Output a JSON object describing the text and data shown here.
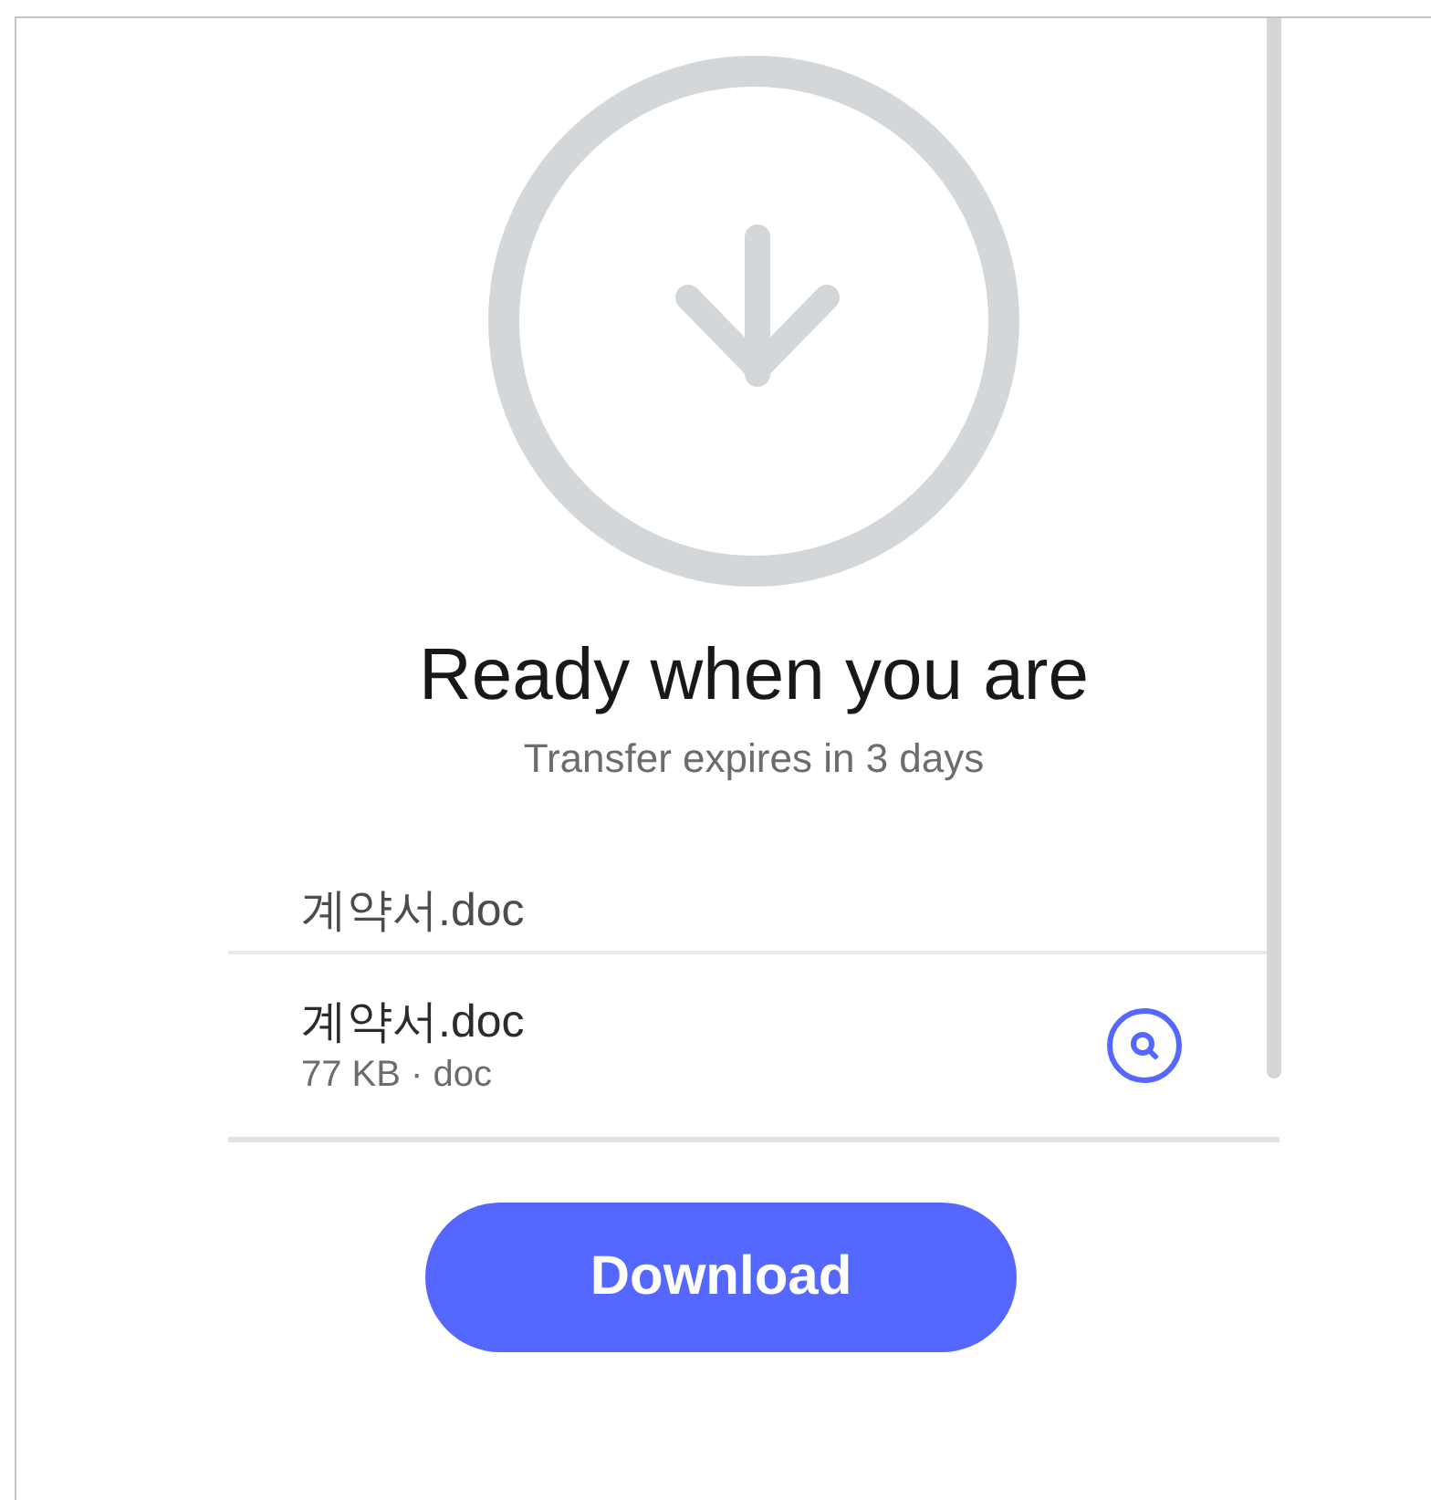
{
  "title": "Ready when you are",
  "subtitle": "Transfer expires in 3 days",
  "transfer_name": "계약서.doc",
  "files": [
    {
      "name": "계약서.doc",
      "details": "77 KB · doc"
    }
  ],
  "button": {
    "label": "Download"
  }
}
